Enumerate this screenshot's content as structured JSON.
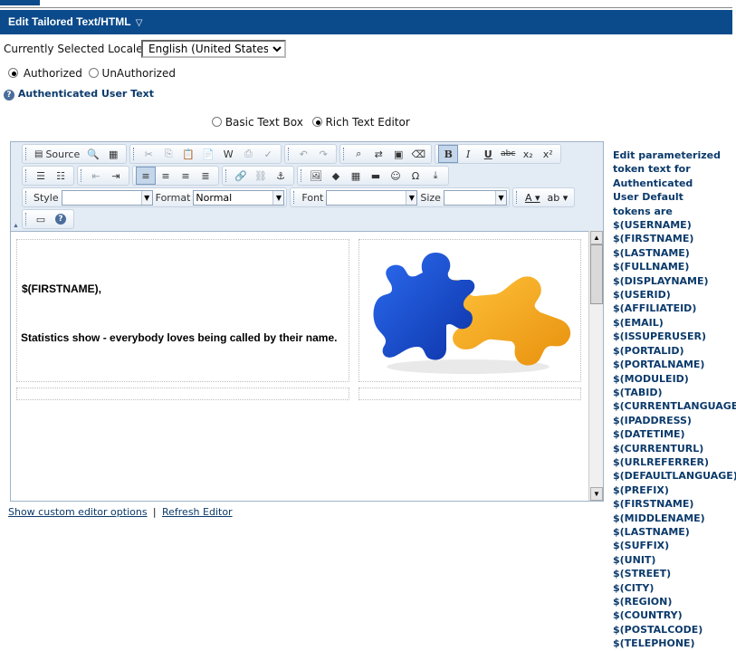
{
  "header": {
    "title": "Edit Tailored Text/HTML",
    "chevron": "▽"
  },
  "locale": {
    "label": "Currently Selected Locale",
    "selected": "English (United States)"
  },
  "auth_radios": {
    "authorized": "Authorized",
    "unauthorized": "UnAuthorized",
    "selected": "authorized"
  },
  "help": {
    "glyph": "?",
    "label": "Authenticated User Text"
  },
  "mode_radios": {
    "basic": "Basic Text Box",
    "rich": "Rich Text Editor",
    "selected": "rich"
  },
  "toolbar": {
    "source_label": "Source",
    "style_label": "Style",
    "style_value": "",
    "format_label": "Format",
    "format_value": "Normal",
    "font_label": "Font",
    "font_value": "",
    "size_label": "Size",
    "size_value": "",
    "bold": "B",
    "italic": "I",
    "underline": "U",
    "strike": "abc",
    "subscript": "x₂",
    "superscript": "x²",
    "omega": "Ω",
    "help": "?"
  },
  "content": {
    "line1": "$(FIRSTNAME),",
    "line2": "Statistics show  -  everybody loves being called by their name."
  },
  "links": {
    "custom_options": "Show custom editor options",
    "separator": "|",
    "refresh": "Refresh Editor"
  },
  "tokens": {
    "intro": "Edit parameterized token text for Authenticated User Default tokens are",
    "list": [
      "$(USERNAME)",
      "$(FIRSTNAME)",
      "$(LASTNAME)",
      "$(FULLNAME)",
      "$(DISPLAYNAME)",
      "$(USERID)",
      "$(AFFILIATEID)",
      "$(EMAIL)",
      "$(ISSUPERUSER)",
      "$(PORTALID)",
      "$(PORTALNAME)",
      "$(MODULEID)",
      "$(TABID)",
      "$(CURRENTLANGUAGE)",
      "$(IPADDRESS)",
      "$(DATETIME)",
      "$(CURRENTURL)",
      "$(URLREFERRER)",
      "$(DEFAULTLANGUAGE)",
      "$(PREFIX)",
      "$(FIRSTNAME)",
      "$(MIDDLENAME)",
      "$(LASTNAME)",
      "$(SUFFIX)",
      "$(UNIT)",
      "$(STREET)",
      "$(CITY)",
      "$(REGION)",
      "$(COUNTRY)",
      "$(POSTALCODE)",
      "$(TELEPHONE)"
    ]
  },
  "colors": {
    "header_bg": "#0b4a8b",
    "link": "#0b3a6b",
    "puzzle_blue": "#1346c8",
    "puzzle_orange": "#f3a41f"
  }
}
